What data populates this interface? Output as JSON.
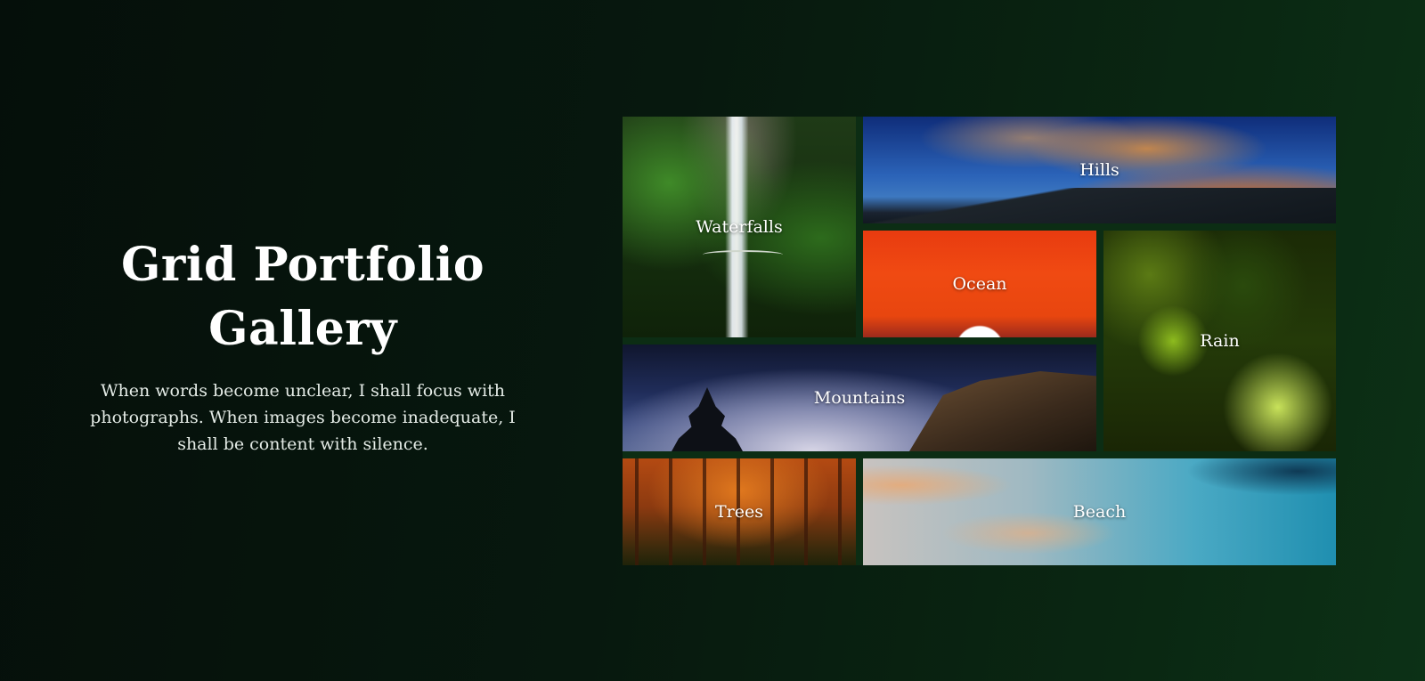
{
  "page": {
    "title_line1": "Grid Portfolio",
    "title_line2": "Gallery",
    "quote": "When words become unclear, I shall focus with photographs. When images become inadequate, I shall be content with silence."
  },
  "gallery": {
    "tiles": [
      {
        "label": "Waterfalls"
      },
      {
        "label": "Hills"
      },
      {
        "label": "Ocean"
      },
      {
        "label": "Rain"
      },
      {
        "label": "Mountains"
      },
      {
        "label": "Trees"
      },
      {
        "label": "Beach"
      }
    ]
  },
  "colors": {
    "background_dark": "#050f0a",
    "background_green": "#0c3116",
    "text": "#ffffff"
  }
}
